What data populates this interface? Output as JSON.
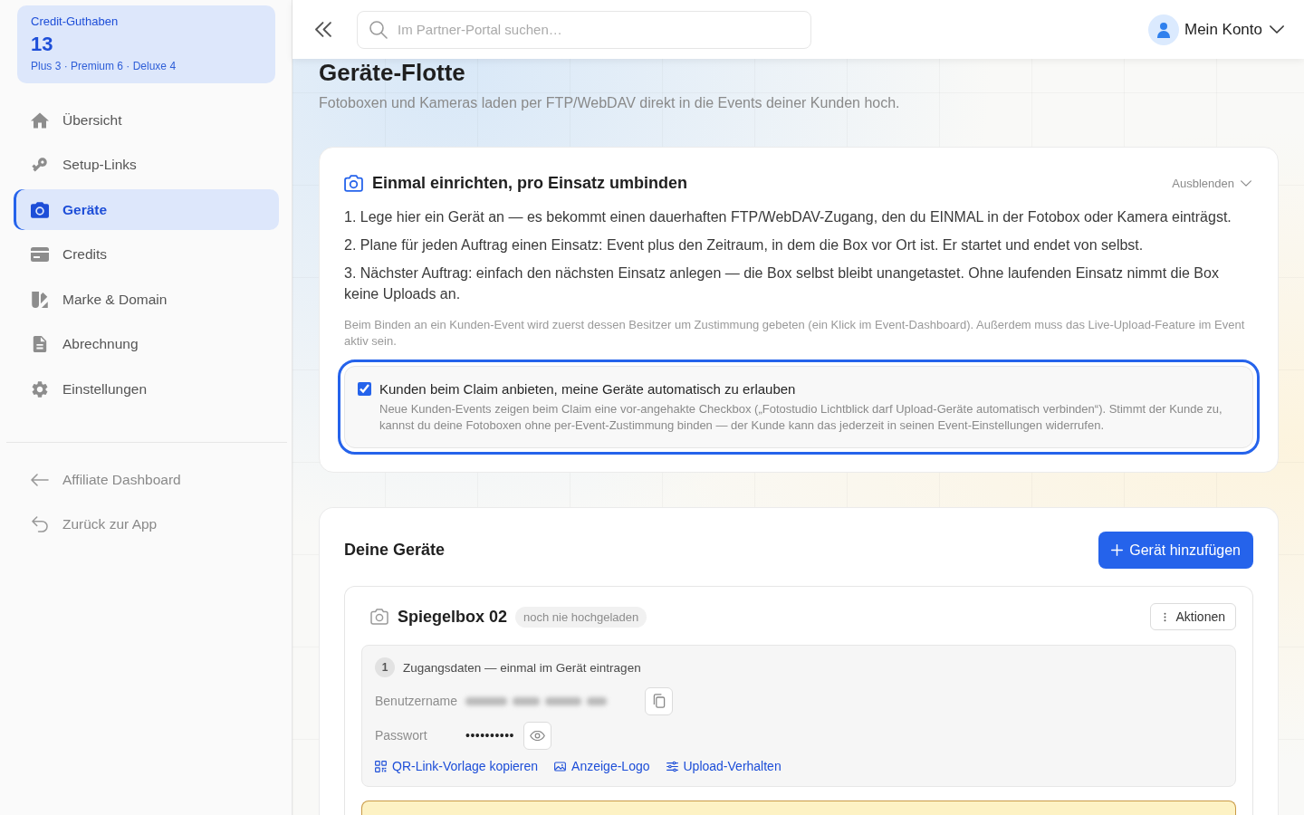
{
  "sidebar": {
    "credit": {
      "title": "Credit-Guthaben",
      "total": "13",
      "breakdown": "Plus 3 · Premium 6 · Deluxe 4"
    },
    "nav": [
      {
        "label": "Übersicht",
        "selected": false
      },
      {
        "label": "Setup-Links",
        "selected": false
      },
      {
        "label": "Geräte",
        "selected": true
      },
      {
        "label": "Credits",
        "selected": false
      },
      {
        "label": "Marke & Domain",
        "selected": false
      },
      {
        "label": "Abrechnung",
        "selected": false
      },
      {
        "label": "Einstellungen",
        "selected": false
      }
    ],
    "secondary_nav": [
      {
        "label": "Affiliate Dashboard"
      },
      {
        "label": "Zurück zur App"
      }
    ]
  },
  "topbar": {
    "search": {
      "placeholder": "Im Partner-Portal suchen…"
    },
    "account": {
      "label": "Mein Konto"
    }
  },
  "page": {
    "title": "Geräte-Flotte",
    "subtitle": "Fotoboxen und Kameras laden per FTP/WebDAV direkt in die Events deiner Kunden hoch."
  },
  "setup_card": {
    "title": "Einmal einrichten, pro Einsatz umbinden",
    "toggle": "Ausblenden",
    "steps": [
      "1. Lege hier ein Gerät an — es bekommt einen dauerhaften FTP/WebDAV-Zugang, den du EINMAL in der Fotobox oder Kamera einträgst.",
      "2. Plane für jeden Auftrag einen Einsatz: Event plus den Zeitraum, in dem die Box vor Ort ist. Er startet und endet von selbst.",
      "3. Nächster Auftrag: einfach den nächsten Einsatz anlegen — die Box selbst bleibt unangetastet. Ohne laufenden Einsatz nimmt die Box keine Uploads an."
    ],
    "note": "Beim Binden an ein Kunden-Event wird zuerst dessen Besitzer um Zustimmung gebeten (ein Klick im Event-Dashboard). Außerdem muss das Live-Upload-Feature im Event aktiv sein.",
    "option": {
      "label": "Kunden beim Claim anbieten, meine Geräte automatisch zu erlauben",
      "description": "Neue Kunden-Events zeigen beim Claim eine vor-angehakte Checkbox („Fotostudio Lichtblick darf Upload-Geräte automatisch verbinden“). Stimmt der Kunde zu, kannst du deine Fotoboxen ohne per-Event-Zustimmung binden — der Kunde kann das jederzeit in seinen Event-Einstellungen widerrufen.",
      "checked": true,
      "highlighted": true
    }
  },
  "devices_card": {
    "title": "Deine Geräte",
    "add_button": "Gerät hinzufügen",
    "devices": [
      {
        "name": "Spiegelbox 02",
        "status": "noch nie hochgeladen",
        "actions": "Aktionen",
        "credentials": {
          "step": "1",
          "title": "Zugangsdaten — einmal im Gerät eintragen",
          "username_label": "Benutzername",
          "password_label": "Passwort",
          "password": "••••••••••",
          "links": [
            "QR-Link-Vorlage kopieren",
            "Anzeige-Logo",
            "Upload-Verhalten"
          ]
        }
      }
    ]
  }
}
